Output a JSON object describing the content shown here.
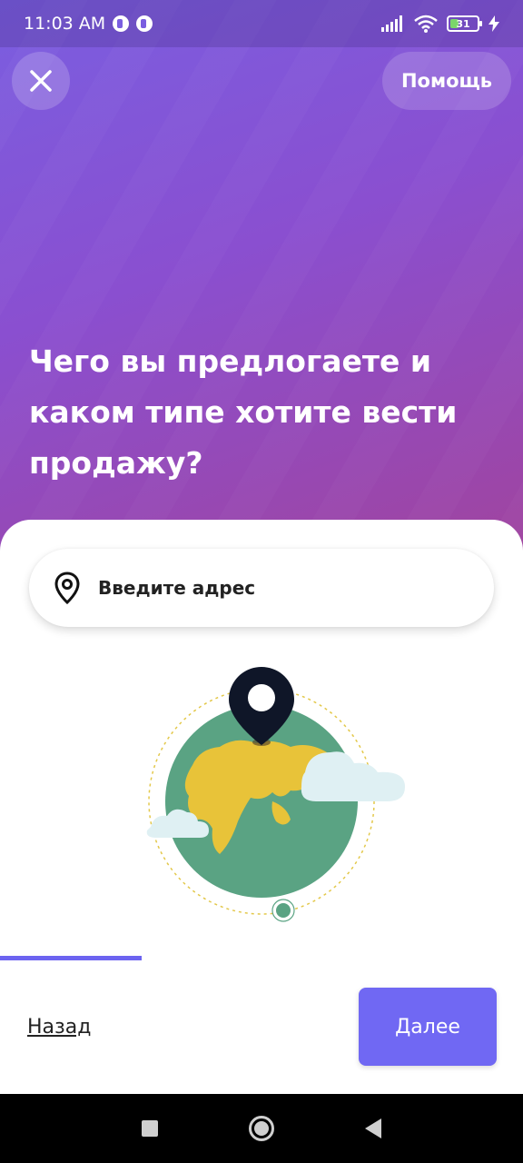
{
  "status_bar": {
    "time": "11:03 AM",
    "battery": "31"
  },
  "header": {
    "close_icon": "close-icon",
    "help_label": "Помощь"
  },
  "title": {
    "line1": "Чего вы предлогаете и",
    "line2": "каком типе хотите вести",
    "line3": "продажу?"
  },
  "address": {
    "placeholder": "Введите адрес",
    "icon": "location-pin-icon"
  },
  "progress": {
    "value": 0.27,
    "color": "#6c63f0"
  },
  "footer": {
    "back_label": "Назад",
    "next_label": "Далее"
  },
  "colors": {
    "accent": "#7068f3",
    "hero_start": "#7a5ee0",
    "hero_end": "#a0449f"
  }
}
